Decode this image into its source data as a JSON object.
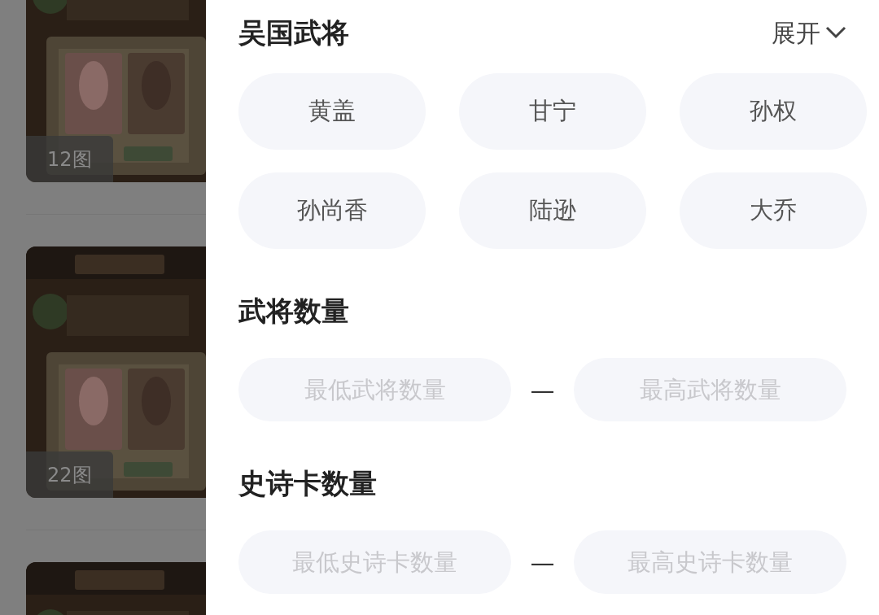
{
  "cards": [
    {
      "kind": "picture",
      "badge": "12图"
    },
    {
      "kind": "picture",
      "badge": "22图"
    },
    {
      "kind": "picture"
    }
  ],
  "sections": [
    {
      "kind": "chips",
      "title": "吴国武将",
      "toggle": "展开",
      "chips": [
        "黄盖",
        "甘宁",
        "孙权",
        "孙尚香",
        "陆逊",
        "大乔"
      ]
    },
    {
      "kind": "range",
      "title": "武将数量",
      "min_placeholder": "最低武将数量",
      "separator": "—",
      "max_placeholder": "最高武将数量"
    },
    {
      "kind": "range",
      "title": "史诗卡数量",
      "min_placeholder": "最低史诗卡数量",
      "separator": "—",
      "max_placeholder": "最高史诗卡数量"
    }
  ]
}
